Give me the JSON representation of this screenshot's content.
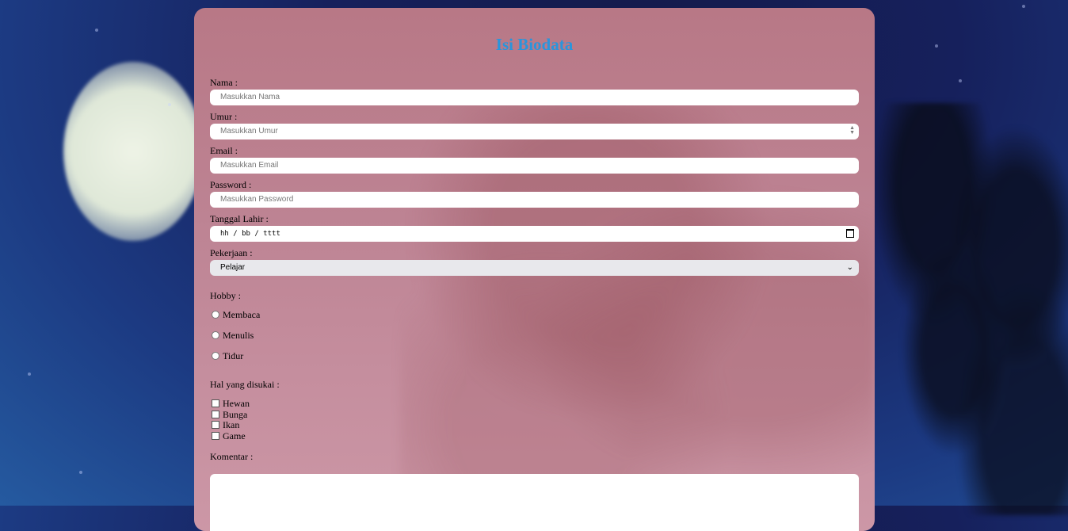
{
  "form": {
    "title": "Isi Biodata",
    "fields": {
      "nama": {
        "label": "Nama :",
        "placeholder": "Masukkan Nama"
      },
      "umur": {
        "label": "Umur :",
        "placeholder": "Masukkan Umur"
      },
      "email": {
        "label": "Email :",
        "placeholder": "Masukkan Email"
      },
      "password": {
        "label": "Password :",
        "placeholder": "Masukkan Password"
      },
      "tanggal_lahir": {
        "label": "Tanggal Lahir :",
        "placeholder": "hh / bb / tttt"
      },
      "pekerjaan": {
        "label": "Pekerjaan :",
        "selected": "Pelajar"
      }
    },
    "hobby": {
      "label": "Hobby :",
      "options": [
        "Membaca",
        "Menulis",
        "Tidur"
      ]
    },
    "disukai": {
      "label": "Hal yang disukai :",
      "options": [
        "Hewan",
        "Bunga",
        "Ikan",
        "Game"
      ]
    },
    "komentar": {
      "label": "Komentar :"
    }
  },
  "colors": {
    "title": "#2a95dc",
    "card": "#bd8393"
  }
}
